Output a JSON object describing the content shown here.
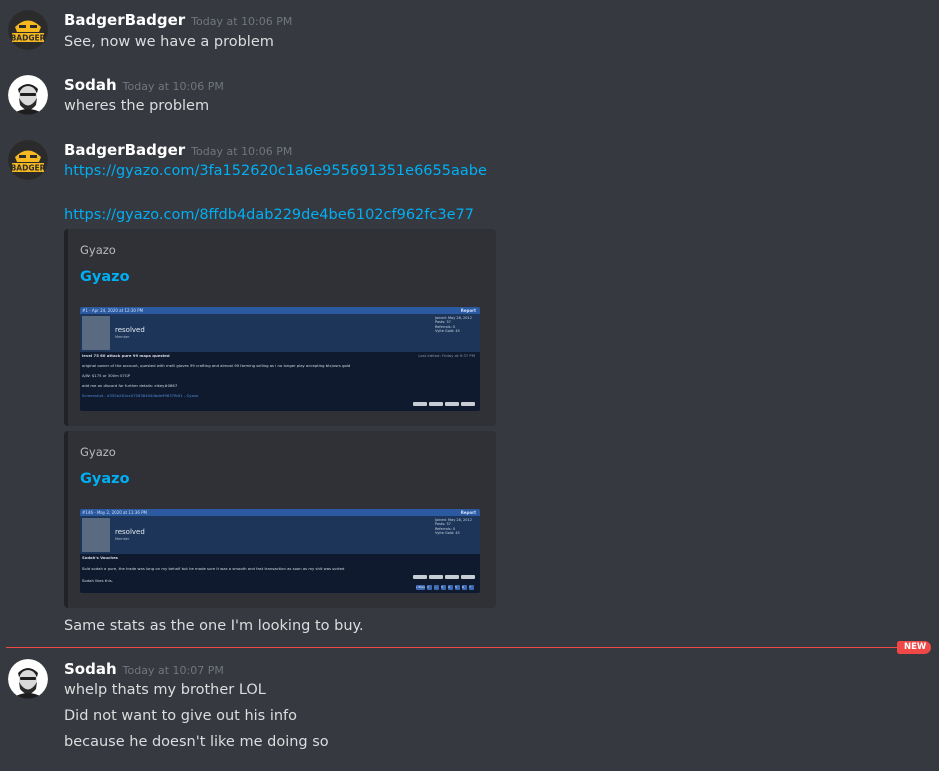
{
  "messages": [
    {
      "author": "BadgerBadger",
      "timestamp": "Today at 10:06 PM",
      "avatar_text": "BADGER",
      "lines": [
        "See, now we have a problem"
      ]
    },
    {
      "author": "Sodah",
      "timestamp": "Today at 10:06 PM",
      "lines": [
        "wheres the problem"
      ]
    },
    {
      "author": "BadgerBadger",
      "timestamp": "Today at 10:06 PM",
      "avatar_text": "BADGER",
      "links": [
        "https://gyazo.com/3fa152620c1a6e955691351e6655aabe",
        "https://gyazo.com/8ffdb4dab229de4be6102cf962fc3e77"
      ],
      "embeds": [
        {
          "provider": "Gyazo",
          "title": "Gyazo",
          "shot": {
            "bar_left": "#1 - Apr 24, 2020 at 12:30 PM",
            "bar_right": "Report",
            "name": "resolved",
            "role": "Member",
            "stats": [
              "Joined: May 28, 2012",
              "Posts: 57",
              "Referrals: 0",
              "Vylte Gold: 45"
            ],
            "heading": "level 75 60 attack pure 99 maps quested",
            "edited": "Last edited: Friday at 9:37 PM",
            "body": [
              "original owner of the account, quested with melli gloves 99 crafting and almost 99 farming selling as i no longer play accepting btc/osrs gold",
              "A/W: $175 or 300m 07GP",
              "add me on discord for further details: eikey#0867"
            ],
            "screenshot_line": "Screenshot - d355e281ec0758384940bde99837fb91 - Gyazo"
          }
        },
        {
          "provider": "Gyazo",
          "title": "Gyazo",
          "shot": {
            "bar_left": "#146 - May 2, 2020 at 11:36 PM",
            "bar_right": "Report",
            "name": "resolved",
            "role": "Member",
            "stats": [
              "Joined: May 28, 2012",
              "Posts: 57",
              "Referrals: 0",
              "Vylte Gold: 45"
            ],
            "heading": "Sodah's Vouches",
            "body": [
              "Sold sodah a pure, the trade was long on my behalf but he made sure it was a smooth and fast transaction as soon as my shit was sorted"
            ],
            "liked_line": "Sodah likes this.",
            "pager": [
              "« Prev",
              "1",
              "...",
              "3",
              "4",
              "5",
              "6",
              "7"
            ]
          }
        }
      ],
      "after_text": "Same stats as the one I'm looking to buy."
    },
    {
      "author": "Sodah",
      "timestamp": "Today at 10:07 PM",
      "lines": [
        "whelp thats my brother LOL",
        "Did not want to give out his info",
        "because he doesn't like me doing so"
      ]
    }
  ],
  "new_badge": "NEW",
  "colors": {
    "background": "#36393f",
    "embed_background": "#2f3136",
    "link": "#00aff4",
    "new_red": "#f04747",
    "badger_gold": "#f5b821"
  },
  "icons": {
    "badger_avatar": "badger-logo-avatar",
    "sodah_avatar": "bearded-man-avatar"
  }
}
